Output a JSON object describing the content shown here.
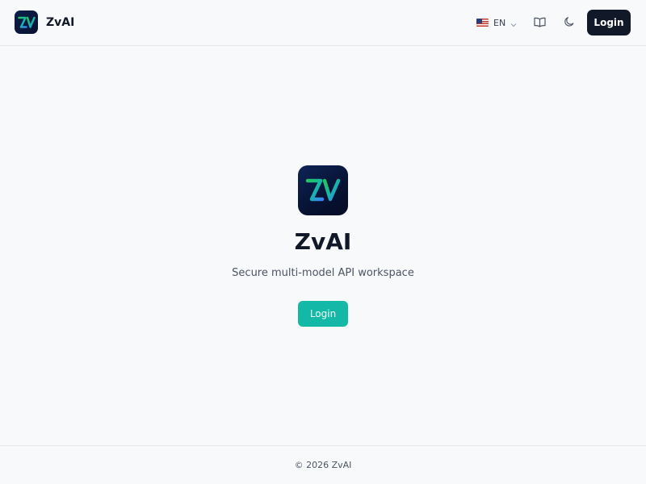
{
  "header": {
    "brand_name": "ZvAI",
    "language": {
      "flag": "us-flag-icon",
      "code": "EN"
    },
    "docs_icon": "book-open-icon",
    "theme_icon": "moon-icon",
    "login_label": "Login"
  },
  "hero": {
    "title": "ZvAI",
    "subtitle": "Secure multi-model API workspace",
    "login_label": "Login"
  },
  "footer": {
    "copyright": "© 2026 ZvAI"
  },
  "colors": {
    "background": "#f8f9fb",
    "primary_dark": "#111827",
    "accent_teal": "#14b8a6",
    "logo_bg": "#071233"
  }
}
